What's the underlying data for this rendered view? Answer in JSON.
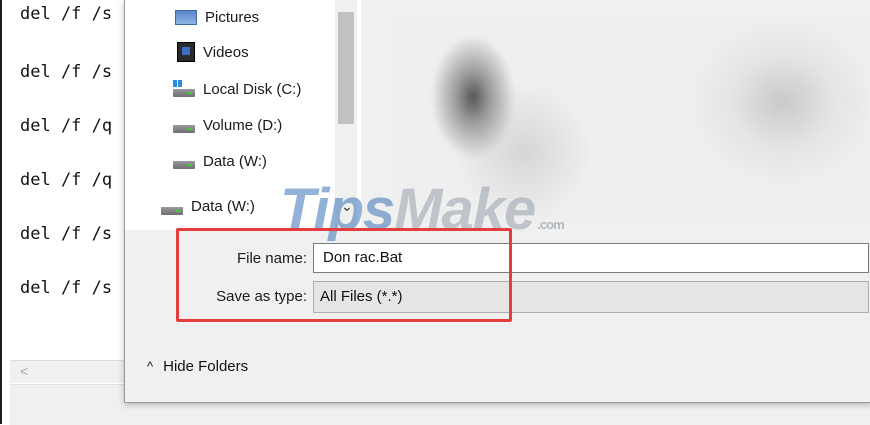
{
  "notepad": {
    "lines": [
      "del /f /s",
      "del /f /s",
      "del /f /q",
      "del /f /q",
      "del /f /s",
      "del /f /s"
    ],
    "scroll_left": "<"
  },
  "dialog": {
    "nav": {
      "items": [
        {
          "label": "Pictures",
          "icon": "pictures-icon"
        },
        {
          "label": "Videos",
          "icon": "videos-icon"
        },
        {
          "label": "Local Disk (C:)",
          "icon": "local-disk-icon"
        },
        {
          "label": "Volume (D:)",
          "icon": "drive-icon"
        },
        {
          "label": "Data (W:)",
          "icon": "drive-icon"
        }
      ]
    },
    "folder_dropdown": {
      "label": "Data (W:)",
      "chevron": "⌄"
    },
    "file_name": {
      "label": "File name:",
      "value": "Don rac.Bat"
    },
    "save_as_type": {
      "label": "Save as type:",
      "value": "All Files  (*.*)"
    },
    "hide_folders": {
      "label": "Hide Folders",
      "caret": "^"
    }
  },
  "watermark": {
    "tips": "Tips",
    "make": "Make",
    "domain": ".com"
  },
  "colors": {
    "highlight": "#e33d3d",
    "dialog_bg": "#f0f0f0",
    "watermark_blue": "#3a72b8"
  }
}
